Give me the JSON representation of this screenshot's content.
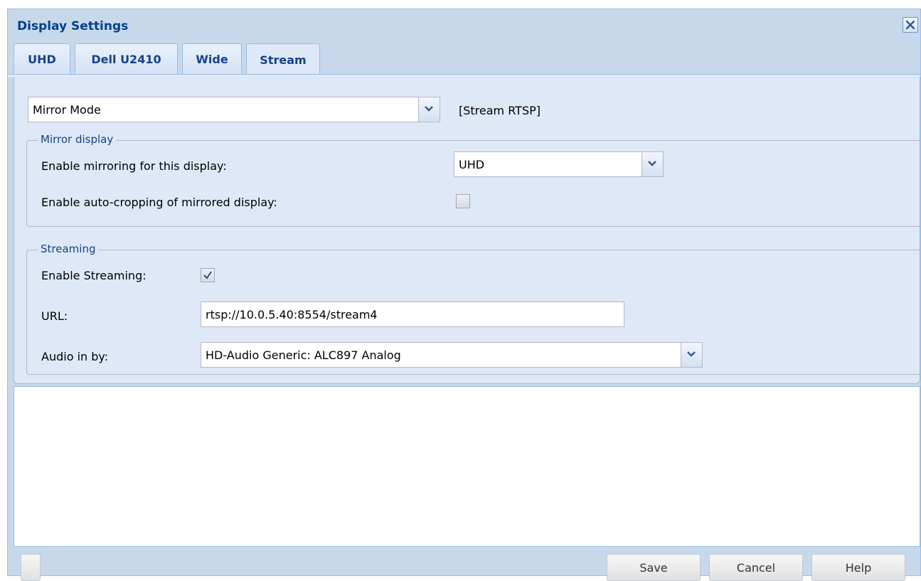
{
  "window": {
    "title": "Display Settings"
  },
  "tabs": [
    {
      "label": "UHD",
      "active": false
    },
    {
      "label": "Dell U2410",
      "active": false
    },
    {
      "label": "Wide",
      "active": false
    },
    {
      "label": "Stream",
      "active": true
    }
  ],
  "mode": {
    "selected": "Mirror Mode",
    "tag": "[Stream RTSP]"
  },
  "mirror": {
    "legend": "Mirror display",
    "enable_label": "Enable mirroring for this display:",
    "enable_value": "UHD",
    "autocrop_label": "Enable auto-cropping of mirrored display:",
    "autocrop_checked": false
  },
  "streaming": {
    "legend": "Streaming",
    "enable_label": "Enable Streaming:",
    "enable_checked": true,
    "url_label": "URL:",
    "url_value": "rtsp://10.0.5.40:8554/stream4",
    "audio_label": "Audio in by:",
    "audio_value": "HD-Audio Generic: ALC897 Analog"
  },
  "footer": {
    "save": "Save",
    "cancel": "Cancel",
    "help": "Help"
  },
  "colors": {
    "accent": "#15428b",
    "panel_bg": "#dfe8f6",
    "header_bg": "#c8d8eb"
  },
  "icons": {
    "close": "close-icon",
    "combo_trigger": "chevron-down-icon",
    "check": "checkmark-icon"
  }
}
